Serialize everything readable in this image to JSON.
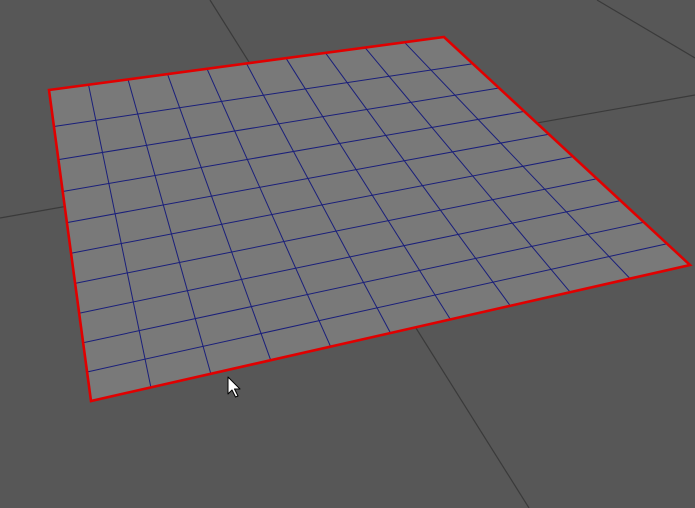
{
  "viewport": {
    "view": "perspective",
    "background_color": "#575757"
  },
  "ground_grid": {
    "line_color": "#3a3a3a"
  },
  "plane": {
    "object_type": "plane",
    "selected": true,
    "segments_length": 10,
    "segments_width": 10,
    "face_color": "#797979",
    "wire_color": "#1a1f7a",
    "selection_color": "#e00000"
  },
  "cursor": {
    "icon": "arrow-cursor-icon"
  }
}
